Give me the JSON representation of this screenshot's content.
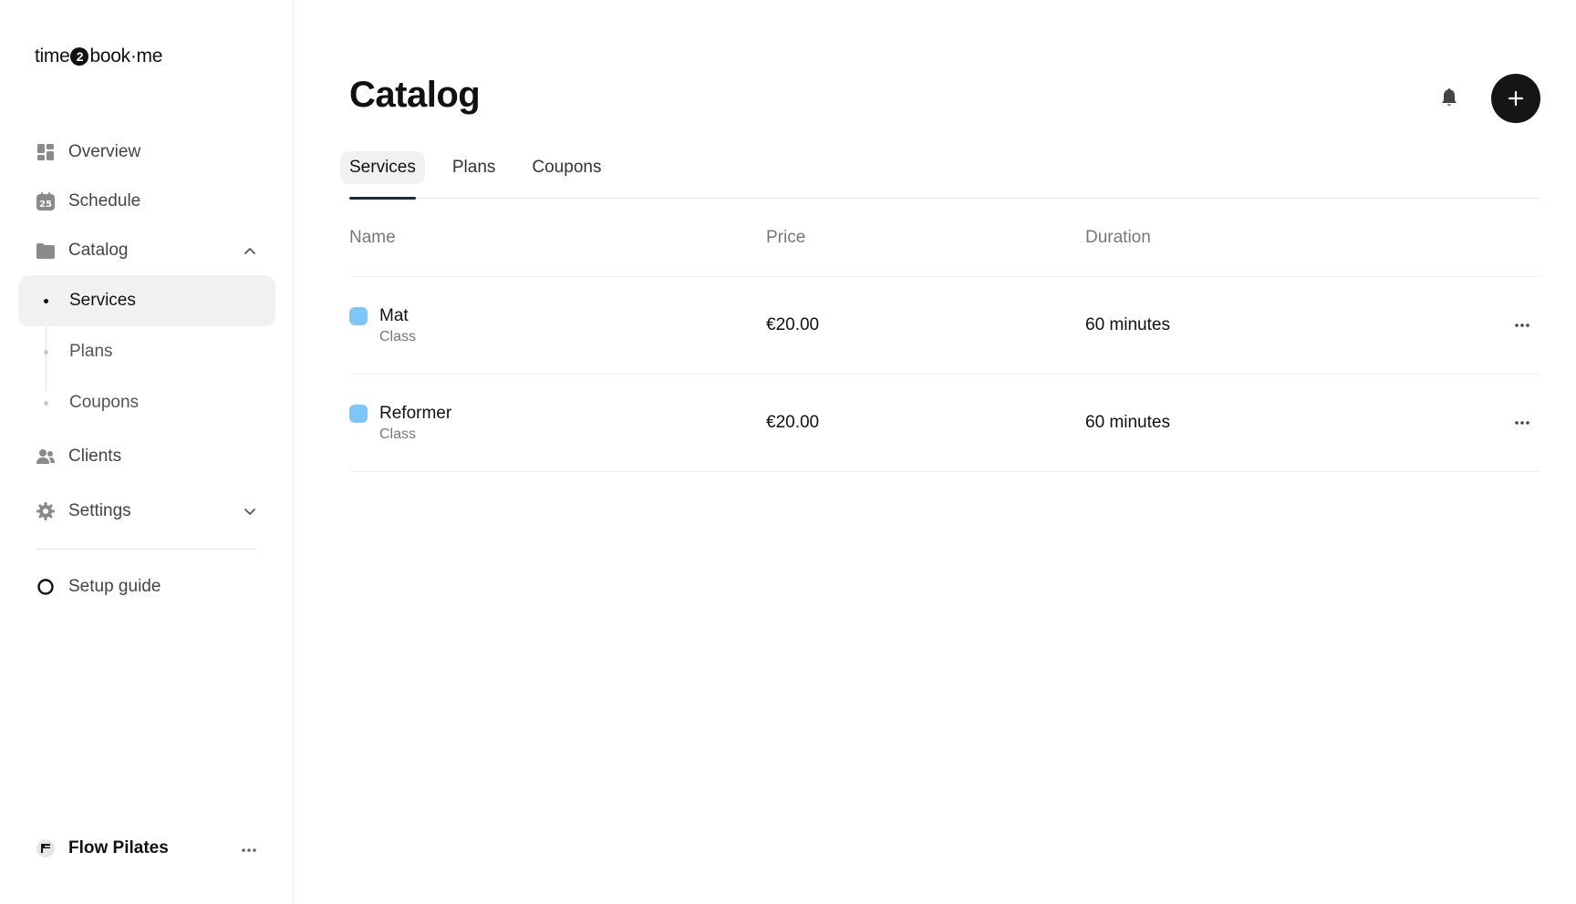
{
  "brand": {
    "logo_left": "time",
    "logo_num": "2",
    "logo_right": "book·me"
  },
  "sidebar": {
    "items": [
      {
        "label": "Overview",
        "icon": "dashboard-icon"
      },
      {
        "label": "Schedule",
        "icon": "calendar-icon",
        "icon_text": "25"
      },
      {
        "label": "Catalog",
        "icon": "folder-icon",
        "expanded": true,
        "children": [
          {
            "label": "Services",
            "active": true
          },
          {
            "label": "Plans"
          },
          {
            "label": "Coupons"
          }
        ]
      },
      {
        "label": "Clients",
        "icon": "users-icon"
      },
      {
        "label": "Settings",
        "icon": "gear-icon",
        "expanded": false
      }
    ],
    "setup_guide": "Setup guide",
    "org_name": "Flow Pilates"
  },
  "header": {
    "title": "Catalog"
  },
  "tabs": [
    {
      "label": "Services",
      "active": true
    },
    {
      "label": "Plans"
    },
    {
      "label": "Coupons"
    }
  ],
  "table": {
    "columns": {
      "name": "Name",
      "price": "Price",
      "duration": "Duration"
    },
    "rows": [
      {
        "name": "Mat",
        "type": "Class",
        "price": "€20.00",
        "duration": "60 minutes",
        "color": "#7cc7f7"
      },
      {
        "name": "Reformer",
        "type": "Class",
        "price": "€20.00",
        "duration": "60 minutes",
        "color": "#7cc7f7"
      }
    ]
  }
}
